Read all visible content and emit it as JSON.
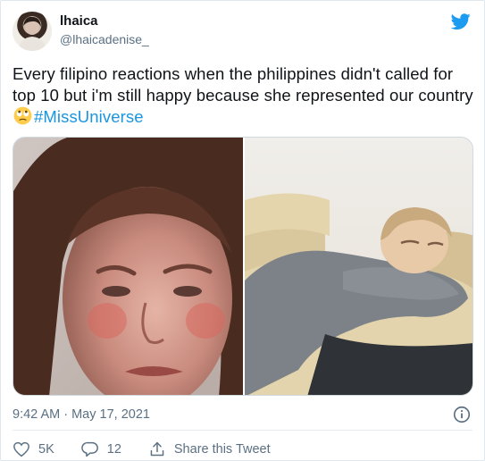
{
  "user": {
    "display_name": "lhaica",
    "handle": "@lhaicadenise_"
  },
  "tweet": {
    "text_main": "Every filipino reactions when the philippines didn't called for top 10 but i'm still happy because she represented our country",
    "emoji": "face-with-rolling-eyes",
    "hashtag": "#MissUniverse",
    "timestamp": "9:42 AM · May 17, 2021"
  },
  "media": [
    {
      "description_icon": "crying-girl-photo"
    },
    {
      "description_icon": "person-lying-on-couch-photo"
    }
  ],
  "actions": {
    "likes": "5K",
    "replies": "12",
    "share_label": "Share this Tweet"
  },
  "colors": {
    "accent": "#1b95e0",
    "secondary_text": "#5b7083",
    "twitter_blue": "#1d9bf0"
  }
}
